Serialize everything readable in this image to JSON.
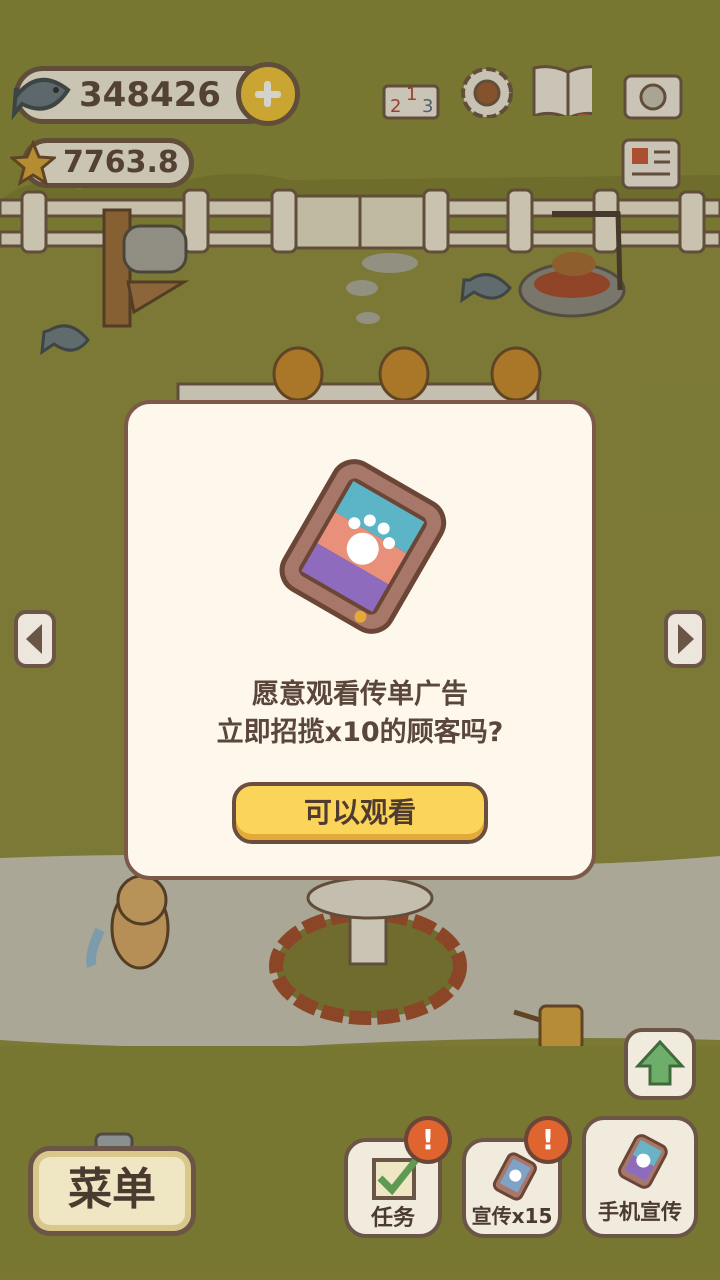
{
  "hud": {
    "fish_count": "348426",
    "star_count": "7763.8",
    "add_icon": "plus-icon",
    "top_icons": [
      "ranking-icon",
      "settings-gear-icon",
      "paw-book-icon",
      "camera-icon",
      "newspaper-icon"
    ]
  },
  "dialog": {
    "line1": "愿意观看传单广告",
    "line2": "立即招揽x10的顾客吗?",
    "watch_label": "可以观看",
    "image_icon": "phone-paw-flyer-icon"
  },
  "nav": {
    "left_icon": "left-arrow-icon",
    "right_icon": "right-arrow-icon",
    "up_icon": "up-arrow-icon"
  },
  "bottom": {
    "menu_label": "菜单",
    "tasks_label": "任务",
    "promote_label": "宣传x15",
    "phone_promote_label": "手机宣传",
    "badge_text": "!"
  },
  "colors": {
    "grass": "#8c8a3e",
    "dialog_bg": "#fdf7ec",
    "button_yellow": "#fbd55a",
    "border_brown": "#6b5546",
    "badge_orange": "#e0642f"
  }
}
